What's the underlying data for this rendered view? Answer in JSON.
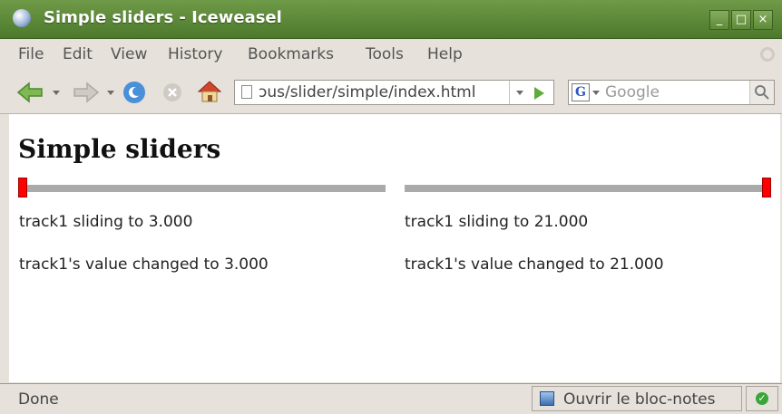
{
  "window": {
    "title": "Simple sliders - Iceweasel",
    "controls": {
      "minimize": "_",
      "maximize": "□",
      "close": "×"
    }
  },
  "menubar": {
    "items": [
      "File",
      "Edit",
      "View",
      "History",
      "Bookmarks",
      "Tools",
      "Help"
    ]
  },
  "navbar": {
    "url": "ɔus/slider/simple/index.html",
    "search": {
      "engine_letter": "G",
      "placeholder": "Google"
    }
  },
  "page": {
    "title": "Simple sliders",
    "sliders": [
      {
        "handle_position": 0,
        "sliding_text": "track1 sliding to 3.000",
        "changed_text": "track1's value changed to 3.000"
      },
      {
        "handle_position": 1,
        "sliding_text": "track1 sliding to 21.000",
        "changed_text": "track1's value changed to 21.000"
      }
    ]
  },
  "statusbar": {
    "status": "Done",
    "notes_label": "Ouvrir le bloc-notes"
  },
  "colors": {
    "titlebar": "#5b8a37",
    "slider_track": "#aaaaaa",
    "slider_handle": "#ff0000"
  }
}
